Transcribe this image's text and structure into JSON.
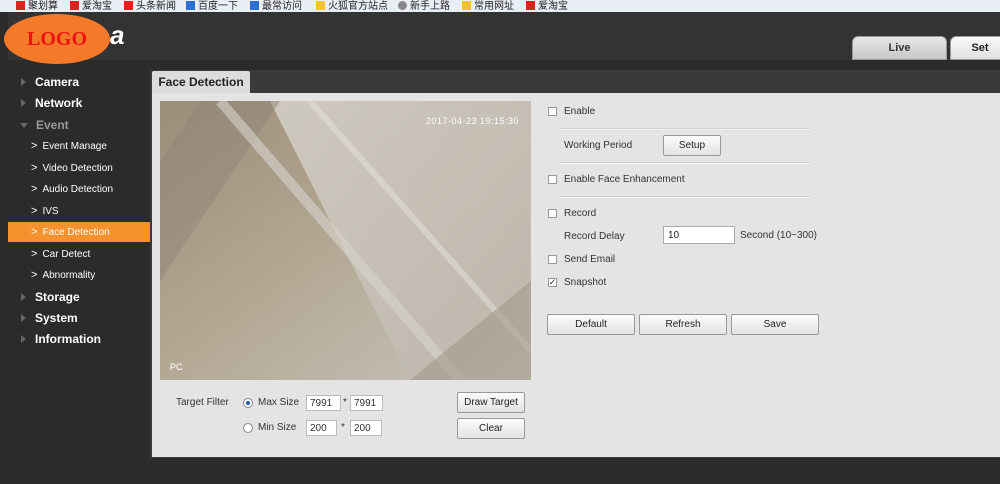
{
  "bookmarks": [
    {
      "label": "聚划算",
      "color": "#d9251c"
    },
    {
      "label": "爱淘宝",
      "color": "#d9251c"
    },
    {
      "label": "头条新闻",
      "color": "#d9251c"
    },
    {
      "label": "百度一下",
      "color": "#2a6fd6"
    },
    {
      "label": "最常访问",
      "color": "#2a6fd6"
    },
    {
      "label": "火狐官方站点",
      "color": "#f2c233"
    },
    {
      "label": "新手上路",
      "color": "#888888"
    },
    {
      "label": "常用网址",
      "color": "#f2c233"
    },
    {
      "label": "爱淘宝",
      "color": "#d9251c"
    }
  ],
  "header": {
    "logo_text": "LOGO",
    "brand_tail": "a",
    "tabs": {
      "live": "Live",
      "setup": "Set"
    }
  },
  "sidebar": {
    "items": [
      {
        "label": "Camera",
        "level": "top"
      },
      {
        "label": "Network",
        "level": "top"
      },
      {
        "label": "Event",
        "level": "top-open"
      },
      {
        "label": "Event Manage",
        "level": "sub"
      },
      {
        "label": "Video Detection",
        "level": "sub"
      },
      {
        "label": "Audio Detection",
        "level": "sub"
      },
      {
        "label": "IVS",
        "level": "sub"
      },
      {
        "label": "Face Detection",
        "level": "sub-active"
      },
      {
        "label": "Car Detect",
        "level": "sub"
      },
      {
        "label": "Abnormality",
        "level": "sub"
      },
      {
        "label": "Storage",
        "level": "top"
      },
      {
        "label": "System",
        "level": "top"
      },
      {
        "label": "Information",
        "level": "top"
      }
    ]
  },
  "page": {
    "title": "Face Detection",
    "video": {
      "timestamp": "2017-04-23 19:15:30",
      "overlay_label": "PC"
    },
    "target_filter": {
      "label": "Target Filter",
      "max_label": "Max Size",
      "max_w": "7991",
      "max_h": "7991",
      "min_label": "Min Size",
      "min_w": "200",
      "min_h": "200",
      "times": "*",
      "draw_target": "Draw Target",
      "clear": "Clear",
      "selected": "max"
    },
    "settings": {
      "enable": "Enable",
      "enable_checked": false,
      "working_period": "Working Period",
      "setup_button": "Setup",
      "face_enhancement": "Enable Face Enhancement",
      "face_enhancement_checked": false,
      "record": "Record",
      "record_checked": false,
      "record_delay": "Record Delay",
      "record_delay_value": "10",
      "record_delay_unit": "Second (10~300)",
      "send_email": "Send Email",
      "send_email_checked": false,
      "snapshot": "Snapshot",
      "snapshot_checked": true,
      "checkmark": "✓"
    },
    "actions": {
      "default": "Default",
      "refresh": "Refresh",
      "save": "Save"
    }
  }
}
